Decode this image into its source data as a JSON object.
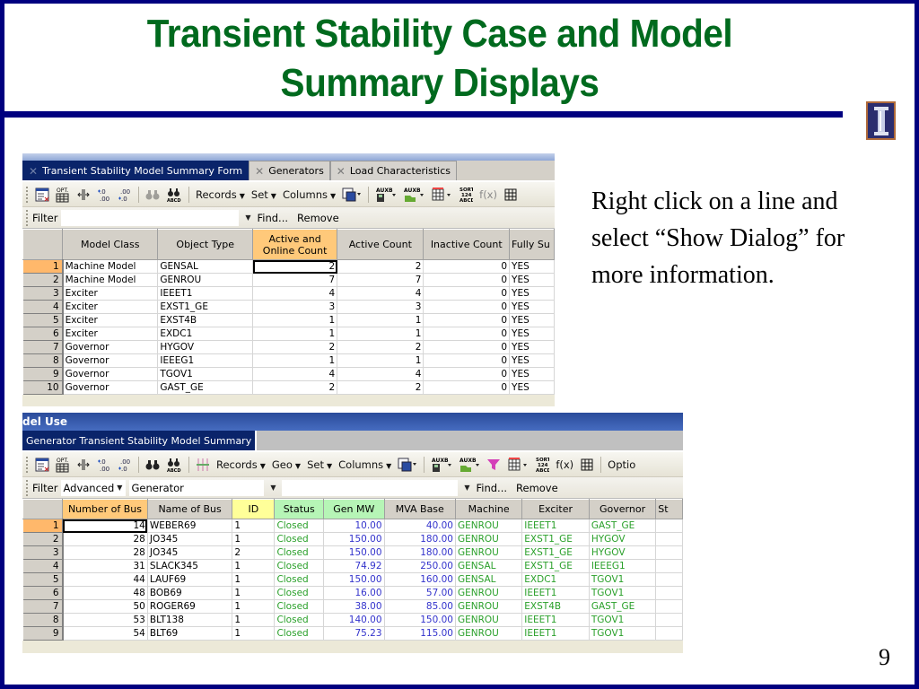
{
  "slide": {
    "title_line1": "Transient Stability Case and Model",
    "title_line2": "Summary Displays",
    "note": "Right click on a line and select “Show Dialog” for more information.",
    "page_number": "9",
    "logo": "university-of-illinois-block-i-icon",
    "colors": {
      "title": "#006a1e",
      "frame": "#00007f"
    }
  },
  "panel1": {
    "tabs": [
      {
        "label": "Transient Stability Model Summary Form",
        "active": true
      },
      {
        "label": "Generators",
        "active": false
      },
      {
        "label": "Load Characteristics",
        "active": false
      }
    ],
    "toolbar": {
      "icons": [
        "table-icon",
        "opt-table-icon",
        "column-resize-icon",
        "increase-decimal-icon",
        "decrease-decimal-icon",
        "find-icon",
        "find-abcd-icon"
      ],
      "opt_label": "OPT.",
      "inc_dec": "+.0\n.00",
      "dec_dec": ".00\n+.0",
      "abcd": "ABCD",
      "records": "Records",
      "set": "Set",
      "columns": "Columns",
      "aux1": "AUXB",
      "aux2": "AUXB",
      "sort": "SORT\n124\nABCD",
      "fx": "f(x)"
    },
    "filter": {
      "label": "Filter",
      "value": "",
      "find": "Find...",
      "remove": "Remove"
    },
    "columns": [
      "Model Class",
      "Object Type",
      "Active and Online Count",
      "Active Count",
      "Inactive Count",
      "Fully Su"
    ],
    "rows": [
      [
        "1",
        "Machine Model",
        "GENSAL",
        "2",
        "2",
        "0",
        "YES"
      ],
      [
        "2",
        "Machine Model",
        "GENROU",
        "7",
        "7",
        "0",
        "YES"
      ],
      [
        "3",
        "Exciter",
        "IEEET1",
        "4",
        "4",
        "0",
        "YES"
      ],
      [
        "4",
        "Exciter",
        "EXST1_GE",
        "3",
        "3",
        "0",
        "YES"
      ],
      [
        "5",
        "Exciter",
        "EXST4B",
        "1",
        "1",
        "0",
        "YES"
      ],
      [
        "6",
        "Exciter",
        "EXDC1",
        "1",
        "1",
        "0",
        "YES"
      ],
      [
        "7",
        "Governor",
        "HYGOV",
        "2",
        "2",
        "0",
        "YES"
      ],
      [
        "8",
        "Governor",
        "IEEEG1",
        "1",
        "1",
        "0",
        "YES"
      ],
      [
        "9",
        "Governor",
        "TGOV1",
        "4",
        "4",
        "0",
        "YES"
      ],
      [
        "10",
        "Governor",
        "GAST_GE",
        "2",
        "2",
        "0",
        "YES"
      ]
    ]
  },
  "panel2": {
    "window_title": "del Use",
    "tab": "Generator Transient Stability Model Summary",
    "toolbar": {
      "records": "Records",
      "geo": "Geo",
      "set": "Set",
      "columns": "Columns",
      "fx": "f(x)",
      "options": "Optio"
    },
    "filter": {
      "label": "Filter",
      "mode": "Advanced",
      "object": "Generator",
      "value": "",
      "find": "Find...",
      "remove": "Remove"
    },
    "columns": [
      "Number of Bus",
      "Name of Bus",
      "ID",
      "Status",
      "Gen MW",
      "MVA Base",
      "Machine",
      "Exciter",
      "Governor",
      "St"
    ],
    "rows": [
      [
        "1",
        "14",
        "WEBER69",
        "1",
        "Closed",
        "10.00",
        "40.00",
        "GENROU",
        "IEEET1",
        "GAST_GE"
      ],
      [
        "2",
        "28",
        "JO345",
        "1",
        "Closed",
        "150.00",
        "180.00",
        "GENROU",
        "EXST1_GE",
        "HYGOV"
      ],
      [
        "3",
        "28",
        "JO345",
        "2",
        "Closed",
        "150.00",
        "180.00",
        "GENROU",
        "EXST1_GE",
        "HYGOV"
      ],
      [
        "4",
        "31",
        "SLACK345",
        "1",
        "Closed",
        "74.92",
        "250.00",
        "GENSAL",
        "EXST1_GE",
        "IEEEG1"
      ],
      [
        "5",
        "44",
        "LAUF69",
        "1",
        "Closed",
        "150.00",
        "160.00",
        "GENSAL",
        "EXDC1",
        "TGOV1"
      ],
      [
        "6",
        "48",
        "BOB69",
        "1",
        "Closed",
        "16.00",
        "57.00",
        "GENROU",
        "IEEET1",
        "TGOV1"
      ],
      [
        "7",
        "50",
        "ROGER69",
        "1",
        "Closed",
        "38.00",
        "85.00",
        "GENROU",
        "EXST4B",
        "GAST_GE"
      ],
      [
        "8",
        "53",
        "BLT138",
        "1",
        "Closed",
        "140.00",
        "150.00",
        "GENROU",
        "IEEET1",
        "TGOV1"
      ],
      [
        "9",
        "54",
        "BLT69",
        "1",
        "Closed",
        "75.23",
        "115.00",
        "GENROU",
        "IEEET1",
        "TGOV1"
      ]
    ]
  }
}
